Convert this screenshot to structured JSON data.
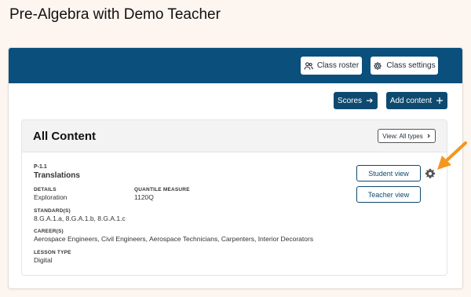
{
  "page": {
    "title": "Pre-Algebra with Demo Teacher"
  },
  "header": {
    "class_roster_label": "Class roster",
    "class_settings_label": "Class settings"
  },
  "toolbar": {
    "scores_label": "Scores",
    "add_content_label": "Add content",
    "scores_icon": "arrow-right-icon",
    "add_icon": "plus-icon"
  },
  "content": {
    "title": "All Content",
    "view_filter": "View: All types"
  },
  "lesson": {
    "code": "P-1.1",
    "title": "Translations",
    "details_label": "DETAILS",
    "details_value": "Exploration",
    "quantile_label": "QUANTILE MEASURE",
    "quantile_value": "1120Q",
    "standards_label": "STANDARD(S)",
    "standards_value": "8.G.A.1.a, 8.G.A.1.b, 8.G.A.1.c",
    "career_label": "CAREER(S)",
    "career_value": "Aerospace Engineers, Civil Engineers, Aerospace Technicians, Carpenters, Interior Decorators",
    "lesson_type_label": "LESSON TYPE",
    "lesson_type_value": "Digital",
    "student_view_label": "Student view",
    "teacher_view_label": "Teacher view"
  },
  "colors": {
    "header_bg": "#0b4f7c",
    "primary_btn": "#0e4a6f",
    "page_bg": "#fdf5f0",
    "annotation_arrow": "#f5961e"
  }
}
